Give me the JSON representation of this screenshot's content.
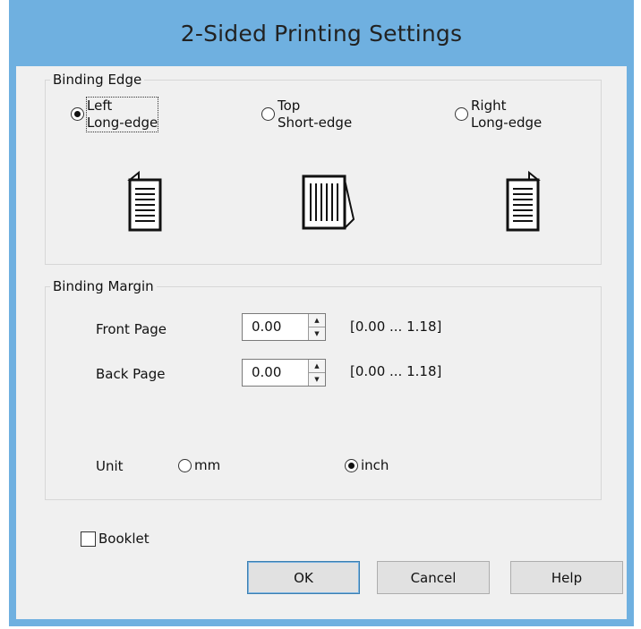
{
  "window": {
    "title": "2-Sided Printing Settings"
  },
  "binding_edge": {
    "title": "Binding Edge",
    "options": [
      {
        "label": "Left\nLong-edge",
        "checked": true,
        "icon": "page-left-binding-icon"
      },
      {
        "label": "Top\nShort-edge",
        "checked": false,
        "icon": "page-top-binding-icon"
      },
      {
        "label": "Right\nLong-edge",
        "checked": false,
        "icon": "page-right-binding-icon"
      }
    ]
  },
  "binding_margin": {
    "title": "Binding Margin",
    "front_page": {
      "label": "Front Page",
      "value": "0.00",
      "range": "[0.00 ... 1.18]"
    },
    "back_page": {
      "label": "Back Page",
      "value": "0.00",
      "range": "[0.00 ... 1.18]"
    },
    "unit": {
      "label": "Unit",
      "options": [
        {
          "label": "mm",
          "checked": false
        },
        {
          "label": "inch",
          "checked": true
        }
      ]
    }
  },
  "booklet": {
    "label": "Booklet",
    "checked": false
  },
  "buttons": {
    "ok": "OK",
    "cancel": "Cancel",
    "help": "Help"
  },
  "colors": {
    "titlebar": "#6fb0e0",
    "client": "#f0f0f0",
    "button_face": "#e1e1e1"
  }
}
